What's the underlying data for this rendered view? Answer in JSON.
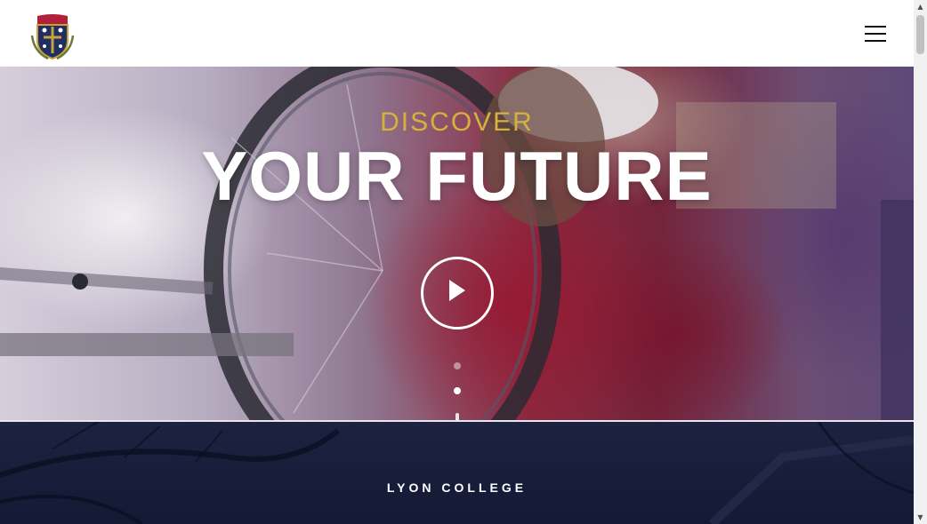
{
  "header": {
    "logo_icon": "college-crest-icon",
    "menu_icon": "hamburger-menu-icon"
  },
  "hero": {
    "eyebrow": "DISCOVER",
    "title": "YOUR FUTURE",
    "play_icon": "play-icon",
    "slides": 2,
    "active_slide": 2
  },
  "section": {
    "label": "LYON COLLEGE"
  },
  "scrollbar": {
    "up_arrow": "▲",
    "down_arrow": "▼"
  },
  "colors": {
    "eyebrow": "#d6b23a",
    "title": "#ffffff",
    "section_bg": "#1c2240",
    "crest_red": "#b0203a",
    "crest_navy": "#1f2f64",
    "crest_gold": "#c9a23a"
  }
}
